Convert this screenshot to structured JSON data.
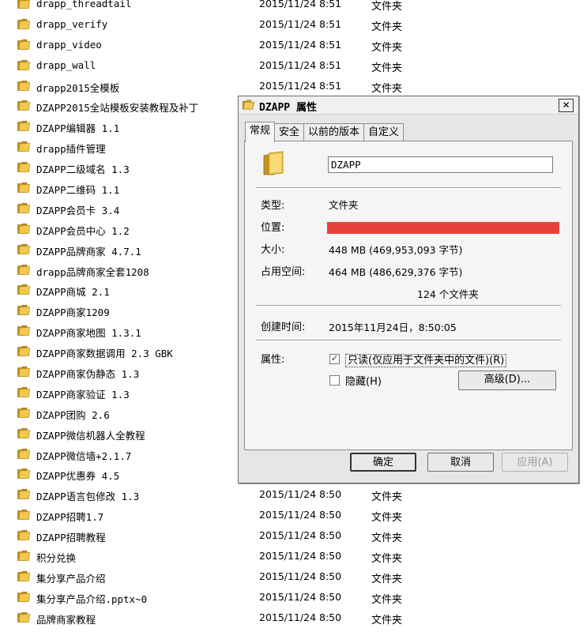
{
  "files": [
    {
      "name": "drapp_threadtail",
      "date": "2015/11/24 8:51",
      "type": "文件夹"
    },
    {
      "name": "drapp_verify",
      "date": "2015/11/24 8:51",
      "type": "文件夹"
    },
    {
      "name": "drapp_video",
      "date": "2015/11/24 8:51",
      "type": "文件夹"
    },
    {
      "name": "drapp_wall",
      "date": "2015/11/24 8:51",
      "type": "文件夹"
    },
    {
      "name": "drapp2015全模板",
      "date": "2015/11/24 8:51",
      "type": "文件夹"
    },
    {
      "name": "DZAPP2015全站模板安装教程及补丁",
      "date": "",
      "type": ""
    },
    {
      "name": "DZAPP编辑器 1.1",
      "date": "",
      "type": ""
    },
    {
      "name": "drapp插件管理",
      "date": "",
      "type": ""
    },
    {
      "name": "DZAPP二级域名 1.3",
      "date": "",
      "type": ""
    },
    {
      "name": "DZAPP二维码 1.1",
      "date": "",
      "type": ""
    },
    {
      "name": "DZAPP会员卡 3.4",
      "date": "",
      "type": ""
    },
    {
      "name": "DZAPP会员中心 1.2",
      "date": "",
      "type": ""
    },
    {
      "name": "DZAPP品牌商家 4.7.1",
      "date": "",
      "type": ""
    },
    {
      "name": "drapp品牌商家全套1208",
      "date": "",
      "type": ""
    },
    {
      "name": "DZAPP商城 2.1",
      "date": "",
      "type": ""
    },
    {
      "name": "DZAPP商家1209",
      "date": "",
      "type": ""
    },
    {
      "name": "DZAPP商家地图 1.3.1",
      "date": "",
      "type": ""
    },
    {
      "name": "DZAPP商家数据调用 2.3 GBK",
      "date": "",
      "type": ""
    },
    {
      "name": "DZAPP商家伪静态 1.3",
      "date": "",
      "type": ""
    },
    {
      "name": "DZAPP商家验证 1.3",
      "date": "",
      "type": ""
    },
    {
      "name": "DZAPP团购 2.6",
      "date": "",
      "type": ""
    },
    {
      "name": "DZAPP微信机器人全教程",
      "date": "",
      "type": ""
    },
    {
      "name": "DZAPP微信墙+2.1.7",
      "date": "",
      "type": ""
    },
    {
      "name": "DZAPP优惠券 4.5",
      "date": "",
      "type": ""
    },
    {
      "name": "DZAPP语言包修改 1.3",
      "date": "2015/11/24 8:50",
      "type": "文件夹"
    },
    {
      "name": "DZAPP招聘1.7",
      "date": "2015/11/24 8:50",
      "type": "文件夹"
    },
    {
      "name": "DZAPP招聘教程",
      "date": "2015/11/24 8:50",
      "type": "文件夹"
    },
    {
      "name": "积分兑换",
      "date": "2015/11/24 8:50",
      "type": "文件夹"
    },
    {
      "name": "集分享产品介绍",
      "date": "2015/11/24 8:50",
      "type": "文件夹"
    },
    {
      "name": "集分享产品介绍.pptx~0",
      "date": "2015/11/24 8:50",
      "type": "文件夹"
    },
    {
      "name": "品牌商家教程",
      "date": "2015/11/24 8:50",
      "type": "文件夹"
    }
  ],
  "dialog": {
    "title": "DZAPP 属性",
    "close": "✕",
    "tabs": [
      "常规",
      "安全",
      "以前的版本",
      "自定义"
    ],
    "folder_name": "DZAPP",
    "type_label": "类型:",
    "type_value": "文件夹",
    "location_label": "位置:",
    "size_label": "大小:",
    "size_value": "448 MB (469,953,093 字节)",
    "disk_label": "占用空间:",
    "disk_value": "464 MB (486,629,376 字节)",
    "contains_value": "124 个文件夹",
    "created_label": "创建时间:",
    "created_value": "2015年11月24日，8:50:05",
    "attr_label": "属性:",
    "readonly_label": "只读(仅应用于文件夹中的文件)(R)",
    "hidden_label": "隐藏(H)",
    "advanced_button": "高级(D)...",
    "ok_button": "确定",
    "cancel_button": "取消",
    "apply_button": "应用(A)",
    "readonly_checked": true,
    "hidden_checked": false,
    "location_redacted_color": "#e8403a"
  }
}
